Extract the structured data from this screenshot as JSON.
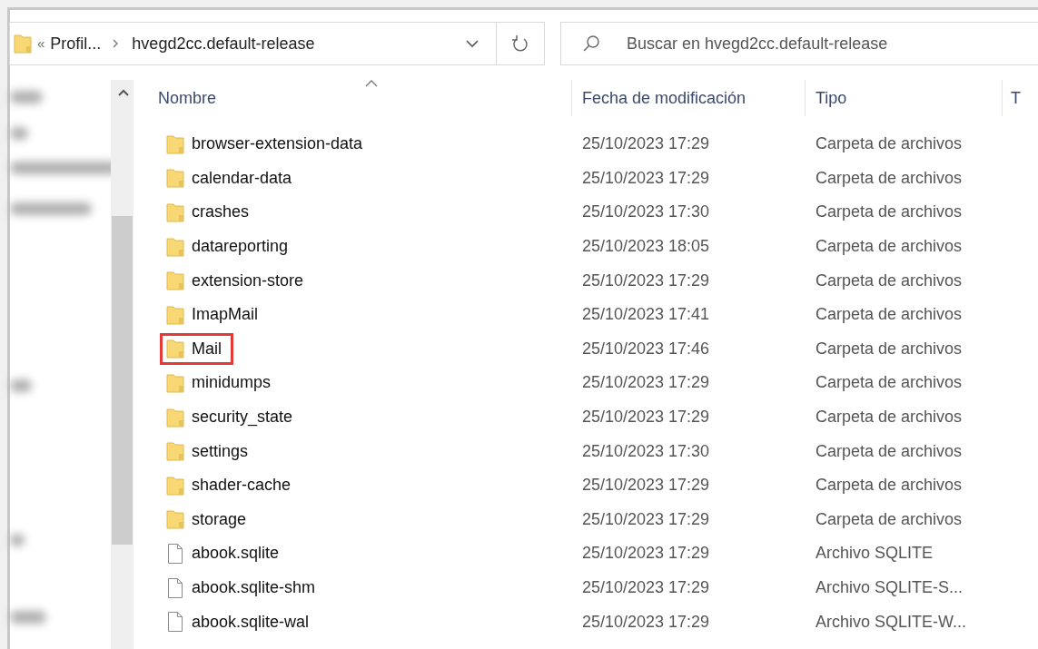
{
  "address_bar": {
    "overflow": "«",
    "crumbs": [
      "Profil...",
      "hvegd2cc.default-release"
    ]
  },
  "search": {
    "placeholder": "Buscar en hvegd2cc.default-release"
  },
  "columns": [
    {
      "label": "Nombre",
      "sorted": true
    },
    {
      "label": "Fecha de modificación",
      "sorted": false
    },
    {
      "label": "Tipo",
      "sorted": false
    },
    {
      "label": "T",
      "sorted": false
    }
  ],
  "rows": [
    {
      "kind": "folder",
      "name": "browser-extension-data",
      "date": "25/10/2023 17:29",
      "type": "Carpeta de archivos",
      "highlighted": false
    },
    {
      "kind": "folder",
      "name": "calendar-data",
      "date": "25/10/2023 17:29",
      "type": "Carpeta de archivos",
      "highlighted": false
    },
    {
      "kind": "folder",
      "name": "crashes",
      "date": "25/10/2023 17:30",
      "type": "Carpeta de archivos",
      "highlighted": false
    },
    {
      "kind": "folder",
      "name": "datareporting",
      "date": "25/10/2023 18:05",
      "type": "Carpeta de archivos",
      "highlighted": false
    },
    {
      "kind": "folder",
      "name": "extension-store",
      "date": "25/10/2023 17:29",
      "type": "Carpeta de archivos",
      "highlighted": false
    },
    {
      "kind": "folder",
      "name": "ImapMail",
      "date": "25/10/2023 17:41",
      "type": "Carpeta de archivos",
      "highlighted": false
    },
    {
      "kind": "folder",
      "name": "Mail",
      "date": "25/10/2023 17:46",
      "type": "Carpeta de archivos",
      "highlighted": true
    },
    {
      "kind": "folder",
      "name": "minidumps",
      "date": "25/10/2023 17:29",
      "type": "Carpeta de archivos",
      "highlighted": false
    },
    {
      "kind": "folder",
      "name": "security_state",
      "date": "25/10/2023 17:29",
      "type": "Carpeta de archivos",
      "highlighted": false
    },
    {
      "kind": "folder",
      "name": "settings",
      "date": "25/10/2023 17:30",
      "type": "Carpeta de archivos",
      "highlighted": false
    },
    {
      "kind": "folder",
      "name": "shader-cache",
      "date": "25/10/2023 17:29",
      "type": "Carpeta de archivos",
      "highlighted": false
    },
    {
      "kind": "folder",
      "name": "storage",
      "date": "25/10/2023 17:29",
      "type": "Carpeta de archivos",
      "highlighted": false
    },
    {
      "kind": "file",
      "name": "abook.sqlite",
      "date": "25/10/2023 17:29",
      "type": "Archivo SQLITE",
      "highlighted": false
    },
    {
      "kind": "file",
      "name": "abook.sqlite-shm",
      "date": "25/10/2023 17:29",
      "type": "Archivo SQLITE-S...",
      "highlighted": false
    },
    {
      "kind": "file",
      "name": "abook.sqlite-wal",
      "date": "25/10/2023 17:29",
      "type": "Archivo SQLITE-W...",
      "highlighted": false
    }
  ]
}
